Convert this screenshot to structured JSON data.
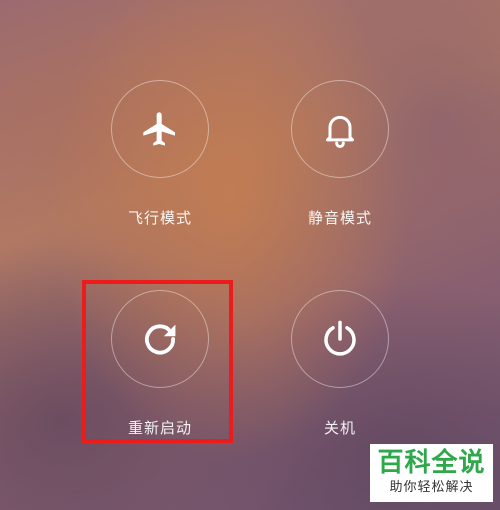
{
  "power_menu": {
    "actions": [
      {
        "label": "飞行模式",
        "icon": "airplane-icon"
      },
      {
        "label": "静音模式",
        "icon": "bell-icon"
      },
      {
        "label": "重新启动",
        "icon": "reboot-icon"
      },
      {
        "label": "关机",
        "icon": "power-icon"
      }
    ],
    "highlighted_action": "重新启动"
  },
  "watermark": {
    "title": "百科全说",
    "subtitle": "助你轻松解决"
  },
  "colors": {
    "highlight": "#ec1c1c",
    "watermark_green": "#2ea84a",
    "icon_white": "#ffffff"
  }
}
